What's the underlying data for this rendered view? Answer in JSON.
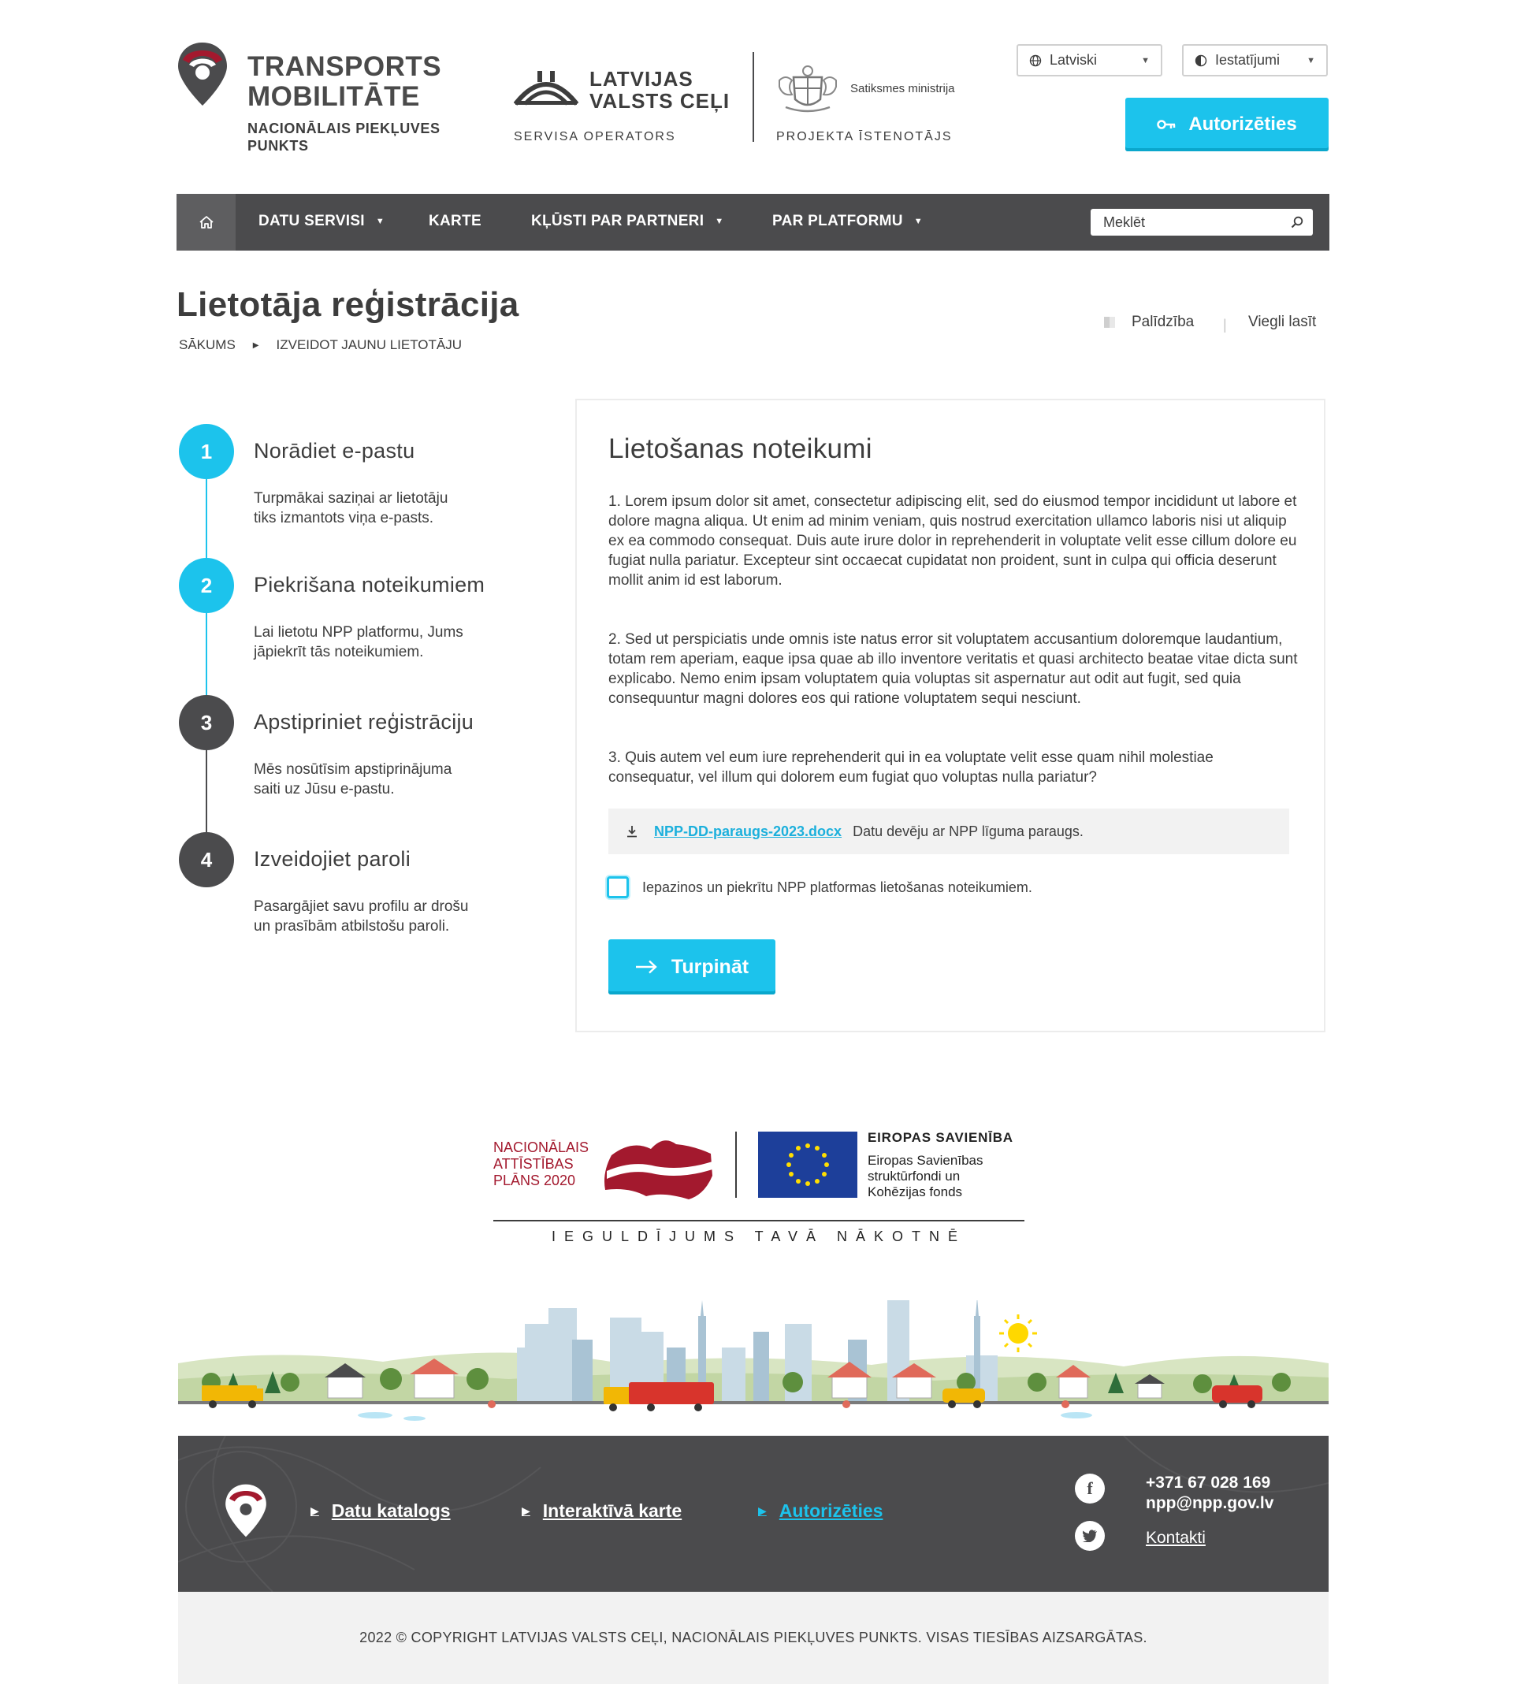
{
  "header": {
    "brand": {
      "title_line1": "TRANSPORTS",
      "title_line2": "MOBILITĀTE",
      "sub_line1": "NACIONĀLAIS PIEKĻUVES",
      "sub_line2": "PUNKTS"
    },
    "operator": {
      "name_line1": "LATVIJAS",
      "name_line2": "VALSTS CEĻI",
      "caption": "SERVISA OPERATORS"
    },
    "implementer": {
      "name": "Satiksmes ministrija",
      "caption": "PROJEKTA ĪSTENOTĀJS"
    },
    "language": {
      "value": "Latviski"
    },
    "settings": {
      "value": "Iestatījumi"
    },
    "auth_label": "Autorizēties"
  },
  "nav": {
    "items": [
      {
        "label": "DATU SERVISI",
        "has_caret": true
      },
      {
        "label": "KARTE",
        "has_caret": false
      },
      {
        "label": "KĻŪSTI PAR PARTNERI",
        "has_caret": true
      },
      {
        "label": "PAR PLATFORMU",
        "has_caret": true
      }
    ],
    "search_placeholder": "Meklēt"
  },
  "page": {
    "title": "Lietotāja reģistrācija",
    "breadcrumb": [
      "SĀKUMS",
      "IZVEIDOT JAUNU LIETOTĀJU"
    ],
    "help_label": "Palīdzība",
    "easy_read_label": "Viegli lasīt"
  },
  "steps": [
    {
      "number": "1",
      "title": "Norādiet e-pastu",
      "desc_line1": "Turpmākai saziņai ar lietotāju",
      "desc_line2": "tiks izmantots viņa e-pasts.",
      "state": "active",
      "color": "#1cc3ec"
    },
    {
      "number": "2",
      "title": "Piekrišana noteikumiem",
      "desc_line1": "Lai lietotu NPP platformu, Jums",
      "desc_line2": "jāpiekrīt tās noteikumiem.",
      "state": "active",
      "color": "#1cc3ec"
    },
    {
      "number": "3",
      "title": "Apstipriniet reģistrāciju",
      "desc_line1": "Mēs nosūtīsim apstiprinājuma",
      "desc_line2": "saiti uz Jūsu e-pastu.",
      "state": "pending",
      "color": "#4b4b4d"
    },
    {
      "number": "4",
      "title": "Izveidojiet paroli",
      "desc_line1": "Pasargājiet savu profilu ar drošu",
      "desc_line2": "un prasībām atbilstošu paroli.",
      "state": "pending",
      "color": "#4b4b4d"
    }
  ],
  "terms": {
    "heading": "Lietošanas noteikumi",
    "p1": "1. Lorem ipsum dolor sit amet, consectetur adipiscing elit, sed do eiusmod tempor incididunt ut labore et dolore magna aliqua. Ut enim ad minim veniam, quis nostrud exercitation ullamco laboris nisi ut aliquip ex ea commodo consequat. Duis aute irure dolor in reprehenderit in voluptate velit esse cillum dolore eu fugiat nulla pariatur. Excepteur sint occaecat cupidatat non proident, sunt in culpa qui officia deserunt mollit anim id est laborum.",
    "p2": "2. Sed ut perspiciatis unde omnis iste natus error sit voluptatem accusantium doloremque laudantium, totam rem aperiam, eaque ipsa quae ab illo inventore veritatis et quasi architecto beatae vitae dicta sunt explicabo. Nemo enim ipsam voluptatem quia voluptas sit aspernatur aut odit aut fugit, sed quia consequuntur magni dolores eos qui ratione voluptatem sequi nesciunt.",
    "p3": "3. Quis autem vel eum iure reprehenderit qui in ea voluptate velit esse quam nihil molestiae consequatur, vel illum qui dolorem eum fugiat quo voluptas nulla pariatur?",
    "file_name": "NPP-DD-paraugs-2023.docx",
    "file_desc": "Datu devēju ar NPP līguma paraugs.",
    "checkbox_label": "Iepazinos un piekrītu NPP platformas lietošanas noteikumiem.",
    "checkbox_checked": false,
    "continue_label": "Turpināt"
  },
  "funding": {
    "nap_line1": "NACIONĀLAIS",
    "nap_line2": "ATTĪSTĪBAS",
    "nap_line3": "PLĀNS 2020",
    "eu_title": "EIROPAS SAVIENĪBA",
    "eu_line1": "Eiropas Savienības",
    "eu_line2": "struktūrfondi un",
    "eu_line3": "Kohēzijas fonds",
    "slogan": "IEGULDĪJUMS TAVĀ NĀKOTNĒ"
  },
  "footer": {
    "links": [
      {
        "label": "Datu katalogs",
        "highlight": false
      },
      {
        "label": "Interaktīvā karte",
        "highlight": false
      },
      {
        "label": "Autorizēties",
        "highlight": true
      }
    ],
    "phone": "+371 67 028 169",
    "email": "npp@npp.gov.lv",
    "contacts_label": "Kontakti",
    "copyright": "2022 © COPYRIGHT LATVIJAS VALSTS CEĻI, NACIONĀLAIS PIEKĻUVES PUNKTS. VISAS TIESĪBAS AIZSARGĀTAS."
  },
  "colors": {
    "accent": "#1cc3ec",
    "dark": "#4b4b4d",
    "brand_red": "#a3192e",
    "eu_blue": "#1d3f9a",
    "eu_star": "#ffde00"
  }
}
